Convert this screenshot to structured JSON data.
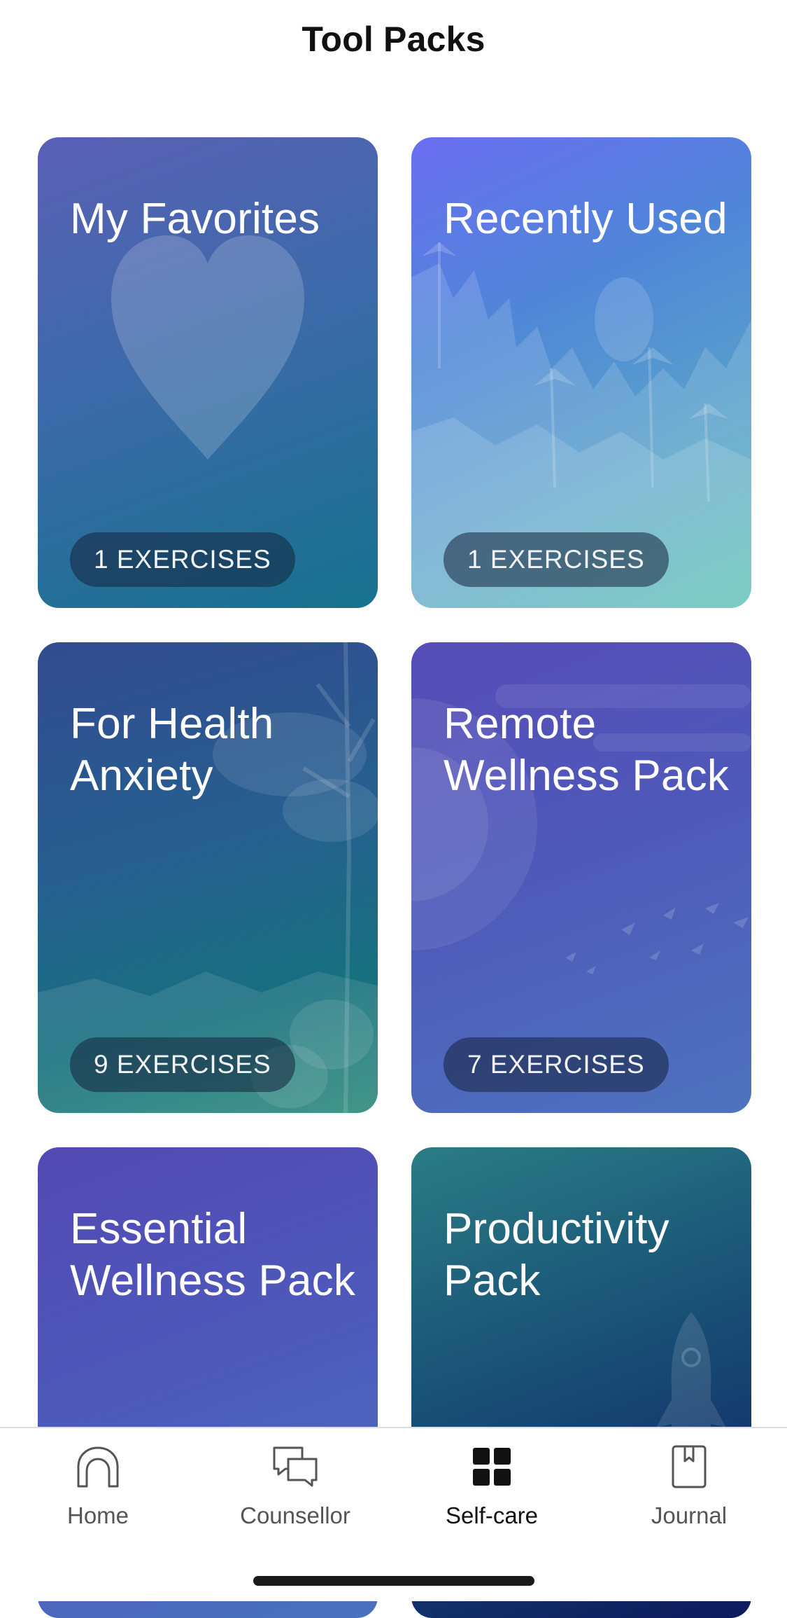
{
  "header": {
    "title": "Tool Packs"
  },
  "cards": [
    {
      "title": "My Favorites",
      "badge": "1 EXERCISES",
      "art": "heart-icon"
    },
    {
      "title": "Recently Used",
      "badge": "1 EXERCISES",
      "art": "jungle-illustration"
    },
    {
      "title": "For Health Anxiety",
      "badge": "9 EXERCISES",
      "art": "tree-illustration"
    },
    {
      "title": "Remote Wellness Pack",
      "badge": "7 EXERCISES",
      "art": "birds-sun-illustration"
    },
    {
      "title": "Essential Wellness Pack",
      "art": "none"
    },
    {
      "title": "Productivity Pack",
      "art": "rocket-icon"
    }
  ],
  "tabbar": {
    "active": "Self-care",
    "tabs": [
      {
        "label": "Home",
        "icon": "home-arch-icon"
      },
      {
        "label": "Counsellor",
        "icon": "chat-bubbles-icon"
      },
      {
        "label": "Self-care",
        "icon": "grid-icon"
      },
      {
        "label": "Journal",
        "icon": "journal-bookmark-icon"
      }
    ]
  },
  "colors": {
    "active_tab": "#111111",
    "inactive_tab": "#555555",
    "badge_bg": "rgba(20,35,60,0.55)"
  }
}
